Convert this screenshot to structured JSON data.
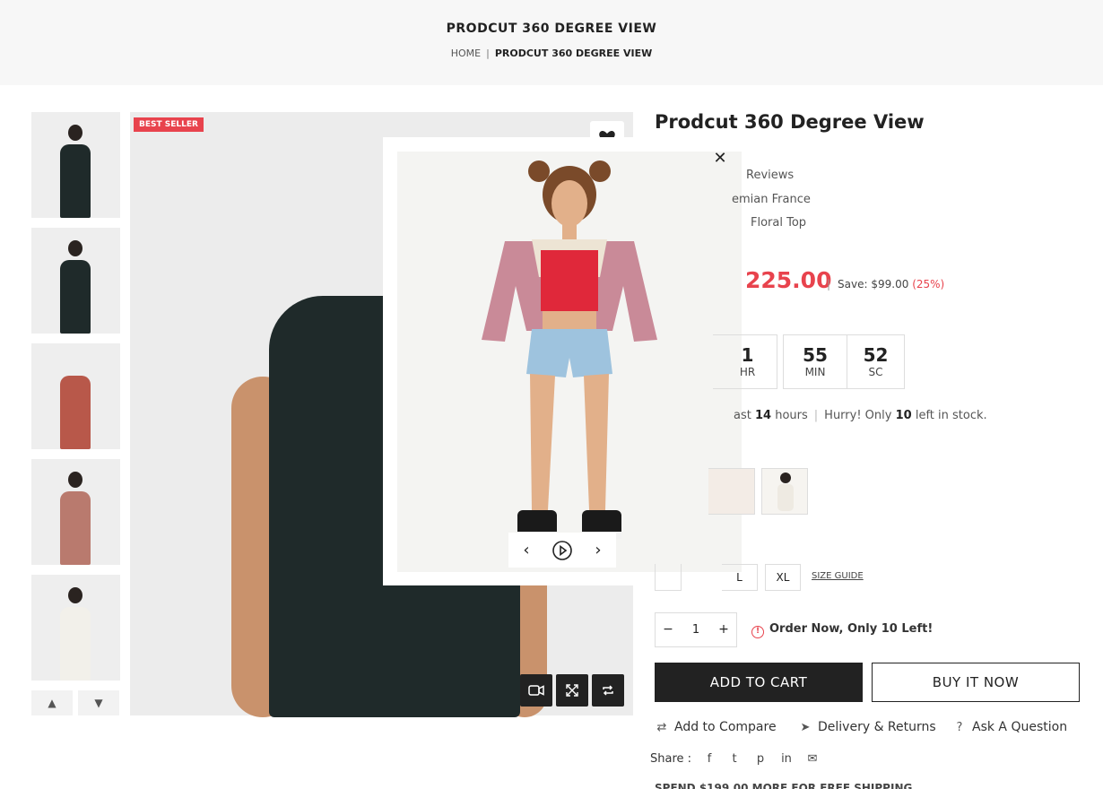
{
  "header": {
    "title": "PRODCUT 360 DEGREE VIEW",
    "breadcrumb": {
      "home": "HOME",
      "separator": "|",
      "current": "PRODCUT 360 DEGREE VIEW"
    }
  },
  "gallery": {
    "badge": "BEST SELLER",
    "thumbnails": [
      {
        "color": "#1f2a2a"
      },
      {
        "color": "#1f2a2a"
      },
      {
        "color": "#b8584a"
      },
      {
        "color": "#b97a6e"
      },
      {
        "color": "#f2f0ea"
      }
    ]
  },
  "product": {
    "title": "Prodcut 360 Degree View",
    "reviews": "Reviews",
    "vendor": "emian France",
    "type": "Floral Top",
    "price": "225.00",
    "save_label": "Save:",
    "save_amount": "$99.00",
    "save_pct": "(25%)",
    "timer": [
      {
        "num": "1",
        "unit": "HR"
      },
      {
        "num": "55",
        "unit": "MIN"
      },
      {
        "num": "52",
        "unit": "SC"
      }
    ],
    "sold": {
      "prefix": "ast",
      "hours": "14",
      "hours_label": "hours"
    },
    "stock": {
      "prefix": "Hurry! Only",
      "count": "10",
      "suffix": "left in stock."
    },
    "sizes": [
      "L",
      "XL"
    ],
    "size_guide": "SIZE GUIDE",
    "qty": {
      "minus": "−",
      "value": "1",
      "plus": "+"
    },
    "order_note": "Order Now, Only 10 Left!",
    "add_to_cart": "ADD TO CART",
    "buy_now": "BUY IT NOW",
    "actions": {
      "compare": "Add to Compare",
      "delivery": "Delivery & Returns",
      "question": "Ask A Question"
    },
    "share_label": "Share :",
    "spend_note": "SPEND $199.00 MORE FOR FREE SHIPPING"
  },
  "viewer": {
    "close": "✕",
    "prev": "‹",
    "play": "▷",
    "next": "›"
  },
  "colors": {
    "accent": "#e8434d",
    "dark": "#222222"
  }
}
